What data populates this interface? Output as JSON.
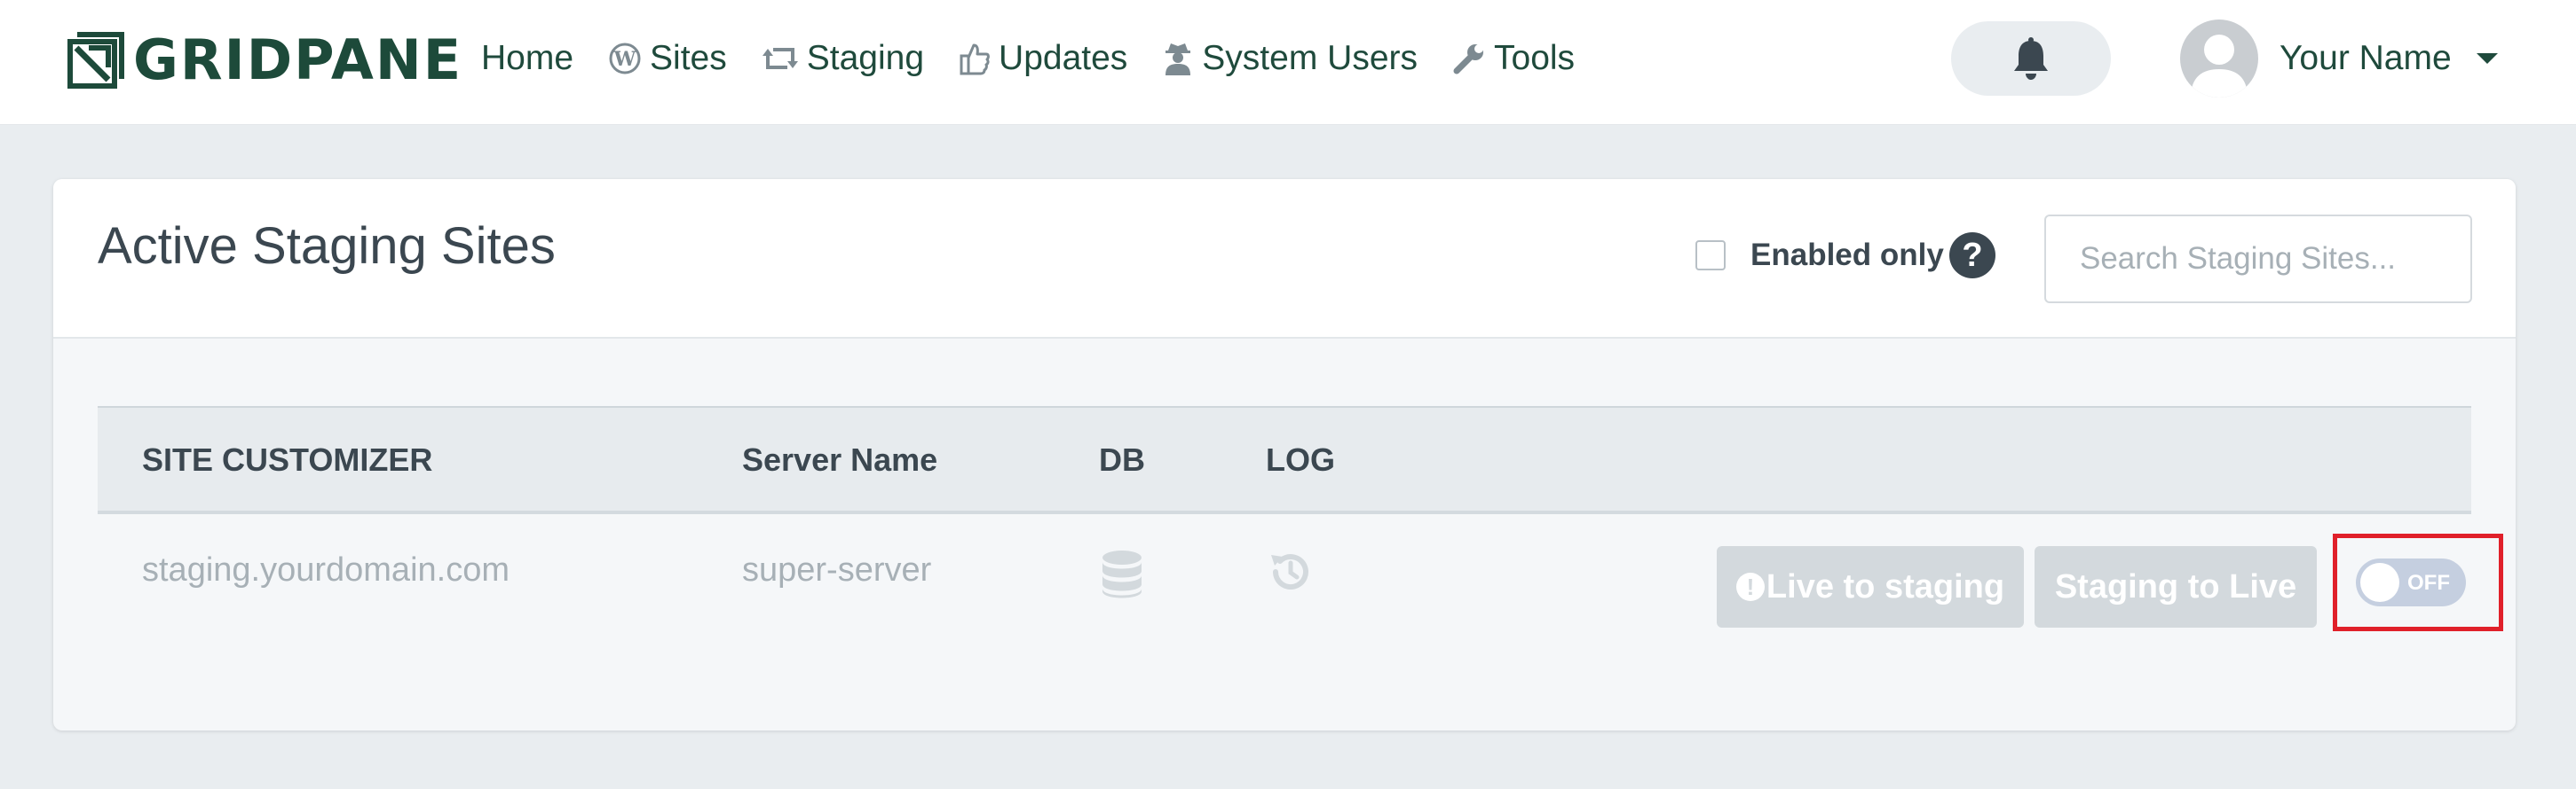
{
  "brand": {
    "name": "GRIDPANE"
  },
  "nav": {
    "items": [
      {
        "label": "Home",
        "icon": "home"
      },
      {
        "label": "Sites",
        "icon": "wordpress-icon"
      },
      {
        "label": "Staging",
        "icon": "retweet-icon"
      },
      {
        "label": "Updates",
        "icon": "thumbs-up-icon"
      },
      {
        "label": "System Users",
        "icon": "user-secret-icon"
      },
      {
        "label": "Tools",
        "icon": "wrench-icon"
      }
    ]
  },
  "user": {
    "name": "Your Name"
  },
  "page": {
    "title": "Active Staging Sites",
    "enabled_only_label": "Enabled only",
    "help_symbol": "?",
    "search_placeholder": "Search Staging Sites..."
  },
  "table": {
    "columns": [
      "SITE CUSTOMIZER",
      "Server Name",
      "DB",
      "LOG"
    ],
    "rows": [
      {
        "site": "staging.yourdomain.com",
        "server": "super-server",
        "db_icon": "database-icon",
        "log_icon": "history-icon",
        "live_to_staging_label": "Live to staging",
        "staging_to_live_label": "Staging to Live",
        "toggle_label": "OFF",
        "toggle_on": false
      }
    ]
  },
  "colors": {
    "brand": "#1d4a3a",
    "highlight": "#e0202a",
    "disabled_button": "#d3d9dd",
    "toggle_off": "#c5cfe0"
  }
}
